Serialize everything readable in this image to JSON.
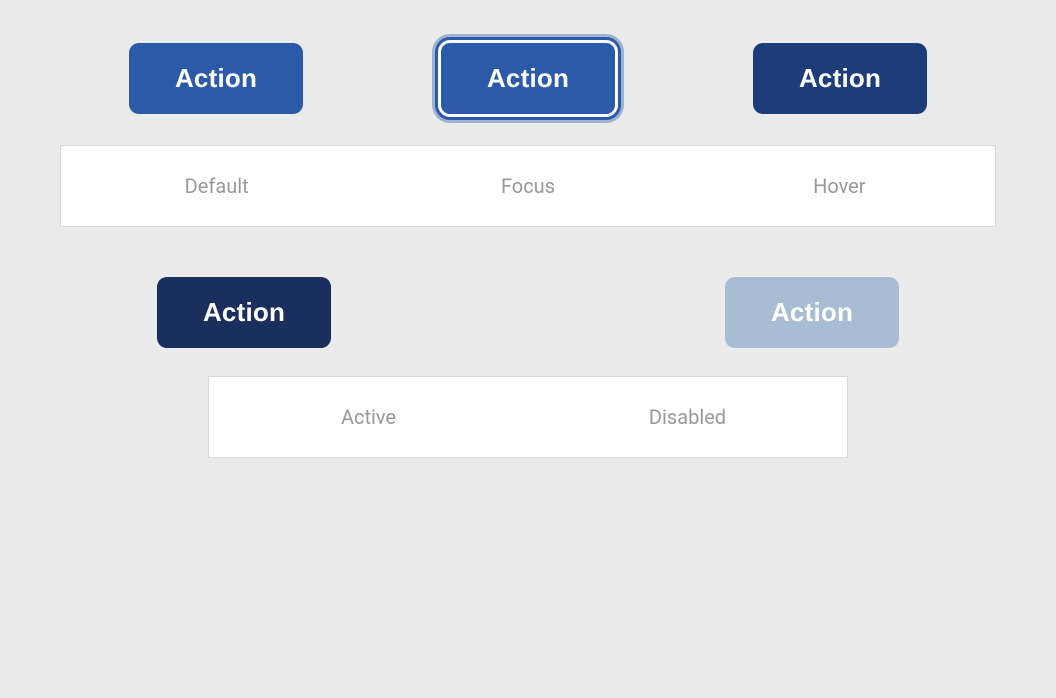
{
  "buttons": {
    "default_label": "Action",
    "focus_label": "Action",
    "hover_label": "Action",
    "active_label": "Action",
    "disabled_label": "Action"
  },
  "state_labels": {
    "default": "Default",
    "focus": "Focus",
    "hover": "Hover",
    "active": "Active",
    "disabled": "Disabled"
  },
  "colors": {
    "default_bg": "#2b5ba8",
    "hover_bg": "#1d3d7a",
    "active_bg": "#1a2f5e",
    "disabled_bg": "#a8bdd4",
    "button_text": "#ffffff",
    "label_text": "#999999",
    "background": "#ebebeb"
  }
}
